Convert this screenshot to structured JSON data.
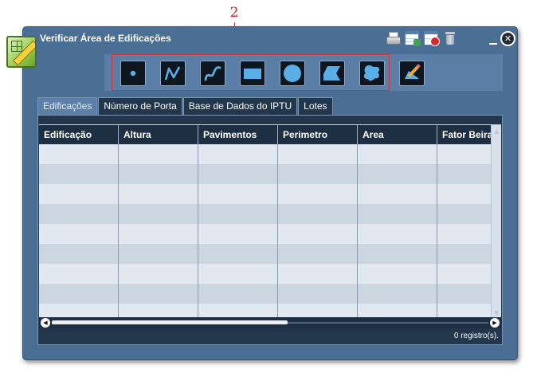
{
  "annotation": {
    "number": "2"
  },
  "window": {
    "title": "Verificar Área de Edificações",
    "title_icons": [
      {
        "name": "printer-icon",
        "label": "Imprimir"
      },
      {
        "name": "table-export-icon",
        "label": "Exportar tabela"
      },
      {
        "name": "table-remove-icon",
        "label": "Remover tabela"
      },
      {
        "name": "trash-icon",
        "label": "Limpar"
      }
    ],
    "minimize_icon": "minimize-icon",
    "close_icon": "close-icon"
  },
  "toolbar": {
    "tools": [
      {
        "name": "point-tool-icon"
      },
      {
        "name": "polyline-tool-icon"
      },
      {
        "name": "freehand-line-tool-icon"
      },
      {
        "name": "rectangle-tool-icon"
      },
      {
        "name": "circle-tool-icon"
      },
      {
        "name": "polygon-tool-icon"
      },
      {
        "name": "freehand-polygon-tool-icon"
      },
      {
        "name": "edit-pencil-tool-icon"
      }
    ]
  },
  "tabs": [
    {
      "label": "Edificações",
      "active": true
    },
    {
      "label": "Número de Porta",
      "active": false
    },
    {
      "label": "Base de Dados do IPTU",
      "active": false
    },
    {
      "label": "Lotes",
      "active": false
    }
  ],
  "grid": {
    "columns": [
      "Edificação",
      "Altura",
      "Pavimentos",
      "Perimetro",
      "Area",
      "Fator Beirai"
    ],
    "rows": []
  },
  "status": {
    "record_count": "0 registro(s)."
  },
  "colors": {
    "window_bg": "#4b6e95",
    "toolbar_bg": "#5a7ea6",
    "tool_bg": "#0e1620",
    "tool_icon": "#5aaee6",
    "header_bg": "#1d2f43",
    "row_odd": "#e2e8ef",
    "row_even": "#ccd6e1",
    "annotation_red": "#d0353a"
  }
}
